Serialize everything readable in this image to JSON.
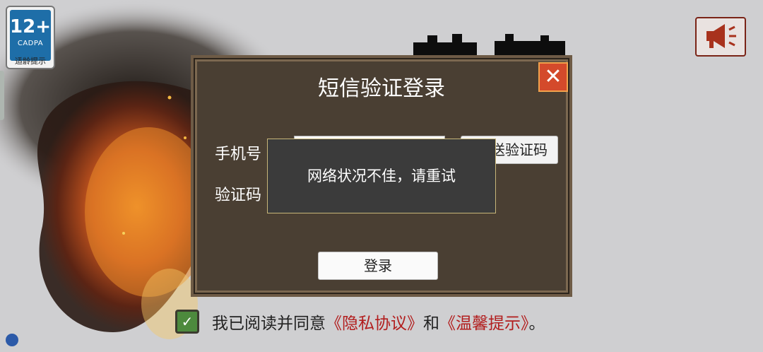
{
  "age_rating": {
    "number": "12+",
    "org": "CADPA",
    "tip": "适龄提示"
  },
  "dialog": {
    "title": "短信验证登录",
    "phone_label": "手机号",
    "code_label": "验证码",
    "send_code_label": "发送验证码",
    "send_code_visible": "送验证码",
    "login_label": "登录"
  },
  "toast": {
    "message": "网络状况不佳，请重试"
  },
  "agreement": {
    "prefix": "我已阅读并同意",
    "privacy_link": "《隐私协议》",
    "and": "和",
    "tips_link": "《温馨提示》",
    "suffix": "。",
    "checked": true
  },
  "colors": {
    "dialog_bg": "#4a3f33",
    "close_button": "#d44a2b",
    "link": "#b21d1d",
    "checkbox": "#4d8a3d"
  }
}
